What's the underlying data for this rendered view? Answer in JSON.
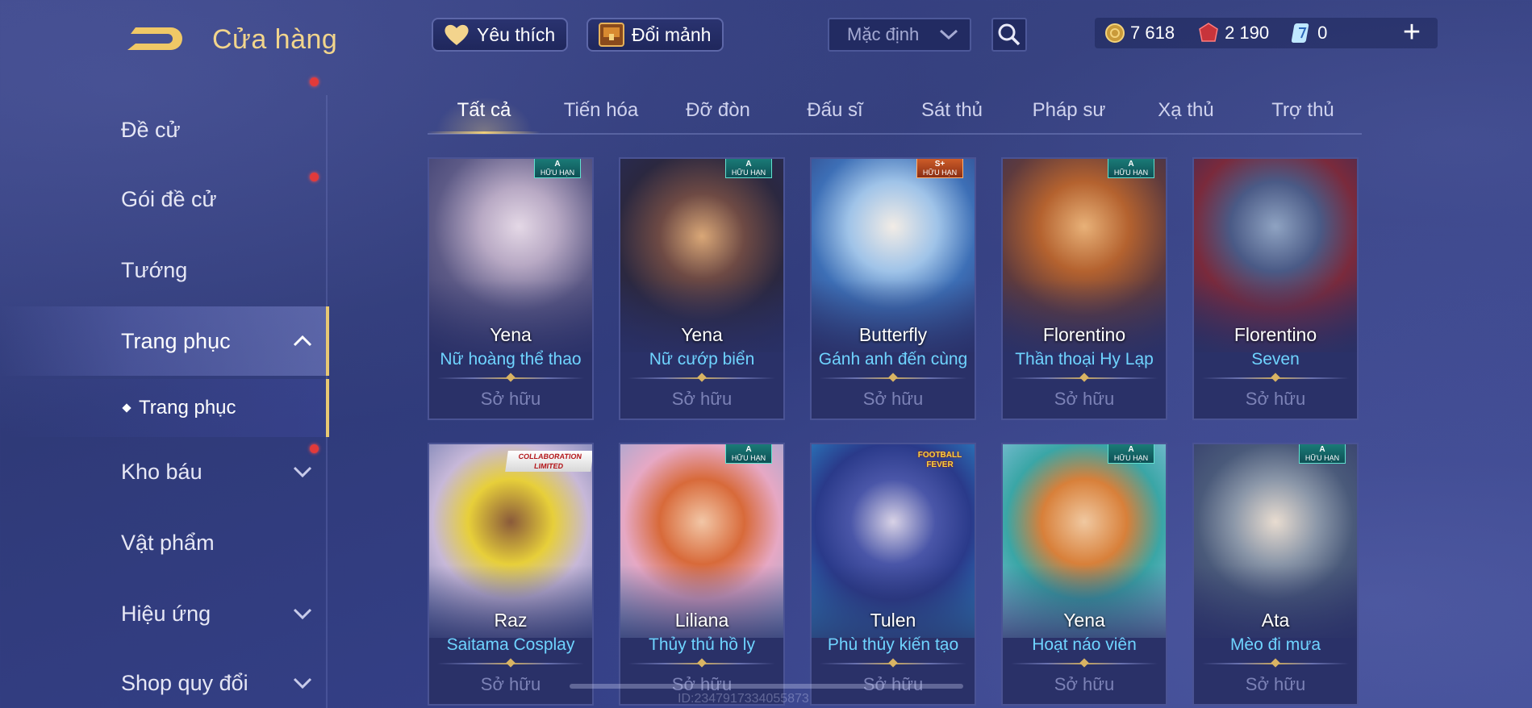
{
  "header": {
    "title": "Cửa hàng",
    "favorites_label": "Yêu thích",
    "exchange_label": "Đổi mảnh",
    "sort_value": "Mặc định",
    "currencies": [
      {
        "icon": "gold-coin-icon",
        "value": "7 618"
      },
      {
        "icon": "voucher-gem-icon",
        "value": "2 190"
      },
      {
        "icon": "ticket-icon",
        "value": "0"
      }
    ],
    "plus_label": "+"
  },
  "sidebar": {
    "items": [
      {
        "label": "Đề cử"
      },
      {
        "label": "Gói đề cử"
      },
      {
        "label": "Tướng"
      },
      {
        "label": "Trang phục"
      },
      {
        "label": "Trang phục"
      },
      {
        "label": "Kho báu"
      },
      {
        "label": "Vật phẩm"
      },
      {
        "label": "Hiệu ứng"
      },
      {
        "label": "Shop quy đổi"
      }
    ]
  },
  "tabs": [
    "Tất cả",
    "Tiến hóa",
    "Đỡ đòn",
    "Đấu sĩ",
    "Sát thủ",
    "Pháp sư",
    "Xạ thủ",
    "Trợ thủ"
  ],
  "cards": [
    {
      "hero": "Yena",
      "skin": "Nữ hoàng thể thao",
      "status": "Sở hữu",
      "badge_rank": "A",
      "badge_text": "HỮU HẠN"
    },
    {
      "hero": "Yena",
      "skin": "Nữ cướp biển",
      "status": "Sở hữu",
      "badge_rank": "A",
      "badge_text": "HỮU HẠN"
    },
    {
      "hero": "Butterfly",
      "skin": "Gánh anh đến cùng",
      "status": "Sở hữu",
      "badge_rank": "S+",
      "badge_text": "HỮU HẠN"
    },
    {
      "hero": "Florentino",
      "skin": "Thần thoại Hy Lạp",
      "status": "Sở hữu",
      "badge_rank": "A",
      "badge_text": "HỮU HẠN"
    },
    {
      "hero": "Florentino",
      "skin": "Seven",
      "status": "Sở hữu"
    },
    {
      "hero": "Raz",
      "skin": "Saitama Cosplay",
      "status": "Sở hữu",
      "collab_text": "COLLABORATION LIMITED"
    },
    {
      "hero": "Liliana",
      "skin": "Thủy thủ hồ ly",
      "status": "Sở hữu",
      "badge_rank": "A",
      "badge_text": "HỮU HẠN"
    },
    {
      "hero": "Tulen",
      "skin": "Phù thủy kiến tạo",
      "status": "Sở hữu",
      "logo_text": "FOOTBALL FEVER"
    },
    {
      "hero": "Yena",
      "skin": "Hoạt náo viên",
      "status": "Sở hữu",
      "badge_rank": "A",
      "badge_text": "HỮU HẠN"
    },
    {
      "hero": "Ata",
      "skin": "Mèo đi mưa",
      "status": "Sở hữu",
      "badge_rank": "A",
      "badge_text": "HỮU HẠN"
    }
  ],
  "footer": {
    "id_text": "ID:2347917334055873"
  },
  "colors": {
    "accent_gold": "#f2d58c",
    "skin_name": "#6fd4ff",
    "owned_text": "#7c82b6",
    "notify_red": "#e23a3a"
  }
}
